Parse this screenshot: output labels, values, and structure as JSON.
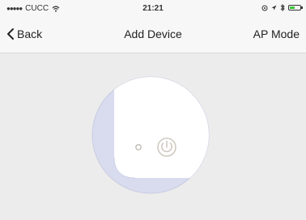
{
  "status_bar": {
    "signal": "●●●●●",
    "carrier": "CUCC",
    "time": "21:21",
    "wifi_icon": "wifi-icon",
    "right_icons": [
      "location-icon",
      "bluetooth-icon",
      "battery-icon"
    ]
  },
  "nav": {
    "back_label": "Back",
    "title": "Add Device",
    "mode_label": "AP Mode"
  },
  "colors": {
    "accent_blue": "#d9dcef",
    "background": "#ececec",
    "device_power": "#cfc9c0"
  }
}
